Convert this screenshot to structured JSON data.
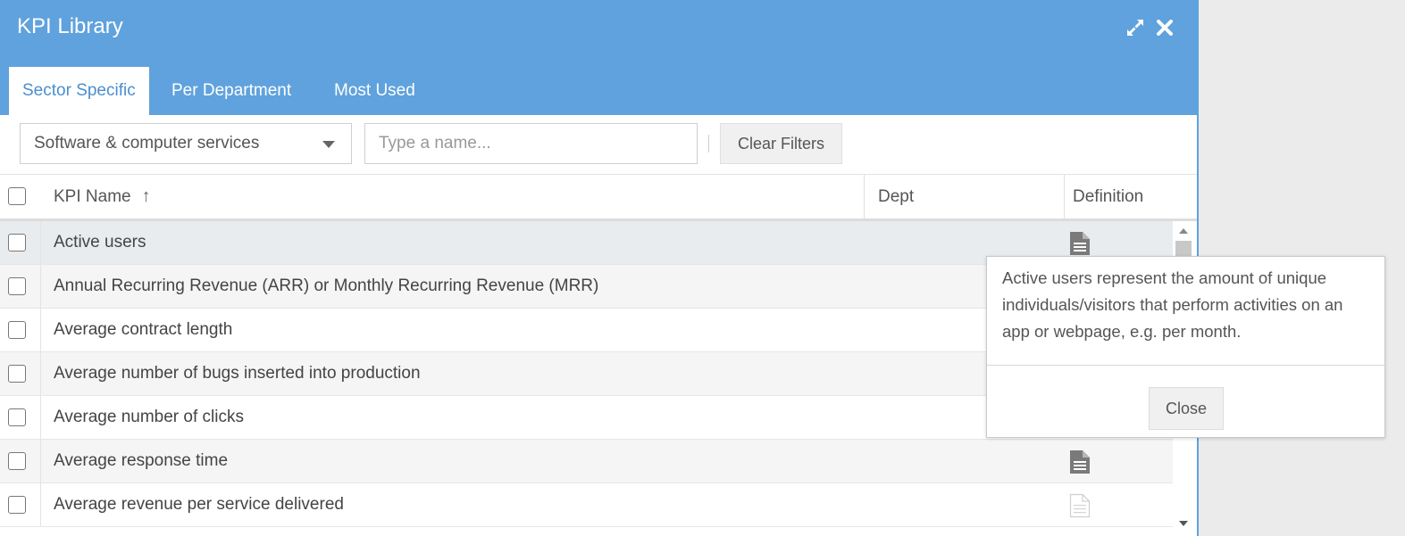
{
  "window": {
    "title": "KPI Library"
  },
  "header": {
    "expand_icon": "expand-icon",
    "close_icon": "close-icon"
  },
  "tabs": [
    {
      "label": "Sector Specific",
      "active": true
    },
    {
      "label": "Per Department",
      "active": false
    },
    {
      "label": "Most Used",
      "active": false
    }
  ],
  "filters": {
    "sector_value": "Software & computer services",
    "name_placeholder": "Type a name...",
    "clear_label": "Clear Filters"
  },
  "table": {
    "columns": [
      "KPI Name",
      "Dept",
      "Definition"
    ],
    "sort_indicator": "↑",
    "rows": [
      {
        "name": "Active users",
        "dept": "",
        "has_definition": true
      },
      {
        "name": "Annual Recurring Revenue (ARR) or Monthly Recurring Revenue (MRR)",
        "dept": "",
        "has_definition": true
      },
      {
        "name": "Average contract length",
        "dept": "",
        "has_definition": true
      },
      {
        "name": "Average number of bugs inserted into production",
        "dept": "",
        "has_definition": true
      },
      {
        "name": "Average number of clicks",
        "dept": "",
        "has_definition": true
      },
      {
        "name": "Average response time",
        "dept": "",
        "has_definition": true
      },
      {
        "name": "Average revenue per service delivered",
        "dept": "",
        "has_definition": false
      }
    ]
  },
  "popover": {
    "text": "Active users represent the amount of unique individuals/visitors  that perform activities on an app or webpage, e.g. per month.",
    "close_label": "Close"
  },
  "colors": {
    "header": "#5fa2dd",
    "active_tab_text": "#4a8fcf"
  }
}
